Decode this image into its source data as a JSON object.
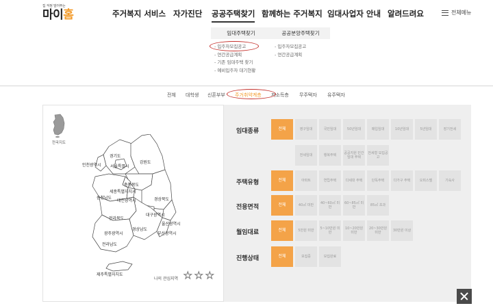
{
  "logo": {
    "tagline": "집 걱정 덜어주는",
    "name_part1": "마이",
    "name_part2": "홈",
    "colors": {
      "accent": "#f39b2a",
      "text": "#222222"
    }
  },
  "nav": {
    "items": [
      "주거복지 서비스",
      "자가진단",
      "공공주택찾기",
      "함께하는 주거복지",
      "임대사업자 안내",
      "알려드려요"
    ],
    "active": "공공주택찾기",
    "all_menu_label": "전체메뉴"
  },
  "dropdown": {
    "col1": {
      "title": "임대주택찾기",
      "items": [
        "- 입주자모집공고",
        "- 연간공급계획",
        "- 기존 임대주택 찾기",
        "- 예비입주자 대기현황"
      ]
    },
    "col2": {
      "title": "공공분양주택찾기",
      "items": [
        "- 입주자모집공고",
        "- 연간공급계획"
      ]
    },
    "highlighted": "- 입주자모집공고"
  },
  "tabs": {
    "items": [
      "전체",
      "대학생",
      "신혼부부",
      "주거취약계층",
      "저소득층",
      "무주택자",
      "유주택자"
    ],
    "active": "주거취약계층"
  },
  "map": {
    "nation_label": "전국지도",
    "regions": [
      "경기도",
      "강원도",
      "인천광역시",
      "서울특별시",
      "충청북도",
      "세종특별자치시",
      "충청남도",
      "대전광역시",
      "경상북도",
      "대구광역시",
      "전라북도",
      "울산광역시",
      "경상남도",
      "광주광역시",
      "부산광역시",
      "전라남도",
      "제주특별자치도"
    ],
    "interest_label": "나의 관심지역",
    "star_icon": "star-outline-icon"
  },
  "filters": {
    "rental_type": {
      "label": "임대종류",
      "options": [
        "전체",
        "영구임대",
        "국민임대",
        "50년임대",
        "매입임대",
        "10년임대",
        "5년임대",
        "장기전세",
        "전세임대",
        "행복주택",
        "공공지원 민간임대 주택",
        "전세형 모집공고"
      ],
      "selected": "전체"
    },
    "house_type": {
      "label": "주택유형",
      "options": [
        "전체",
        "아파트",
        "연립주택",
        "다세대 주택",
        "단독주택",
        "다가구 주택",
        "오피스텔",
        "기숙사"
      ],
      "selected": "전체"
    },
    "area": {
      "label": "전용면적",
      "options": [
        "전체",
        "40㎡ 미만",
        "40~60㎡ 미만",
        "60~85㎡ 미만",
        "85㎡ 초과"
      ],
      "selected": "전체"
    },
    "rent": {
      "label": "월임대료",
      "options": [
        "전체",
        "5만원 미만",
        "5~10만원 미만",
        "10~20만원 미만",
        "20~30만원 미만",
        "30만원 이상"
      ],
      "selected": "전체"
    },
    "status": {
      "label": "진행상태",
      "options": [
        "전체",
        "모집중",
        "모집완료"
      ],
      "selected": "전체"
    },
    "colors": {
      "selected_bg": "#f4a348",
      "option_bg": "#e3e3e3"
    }
  },
  "close_icon": "close-icon"
}
